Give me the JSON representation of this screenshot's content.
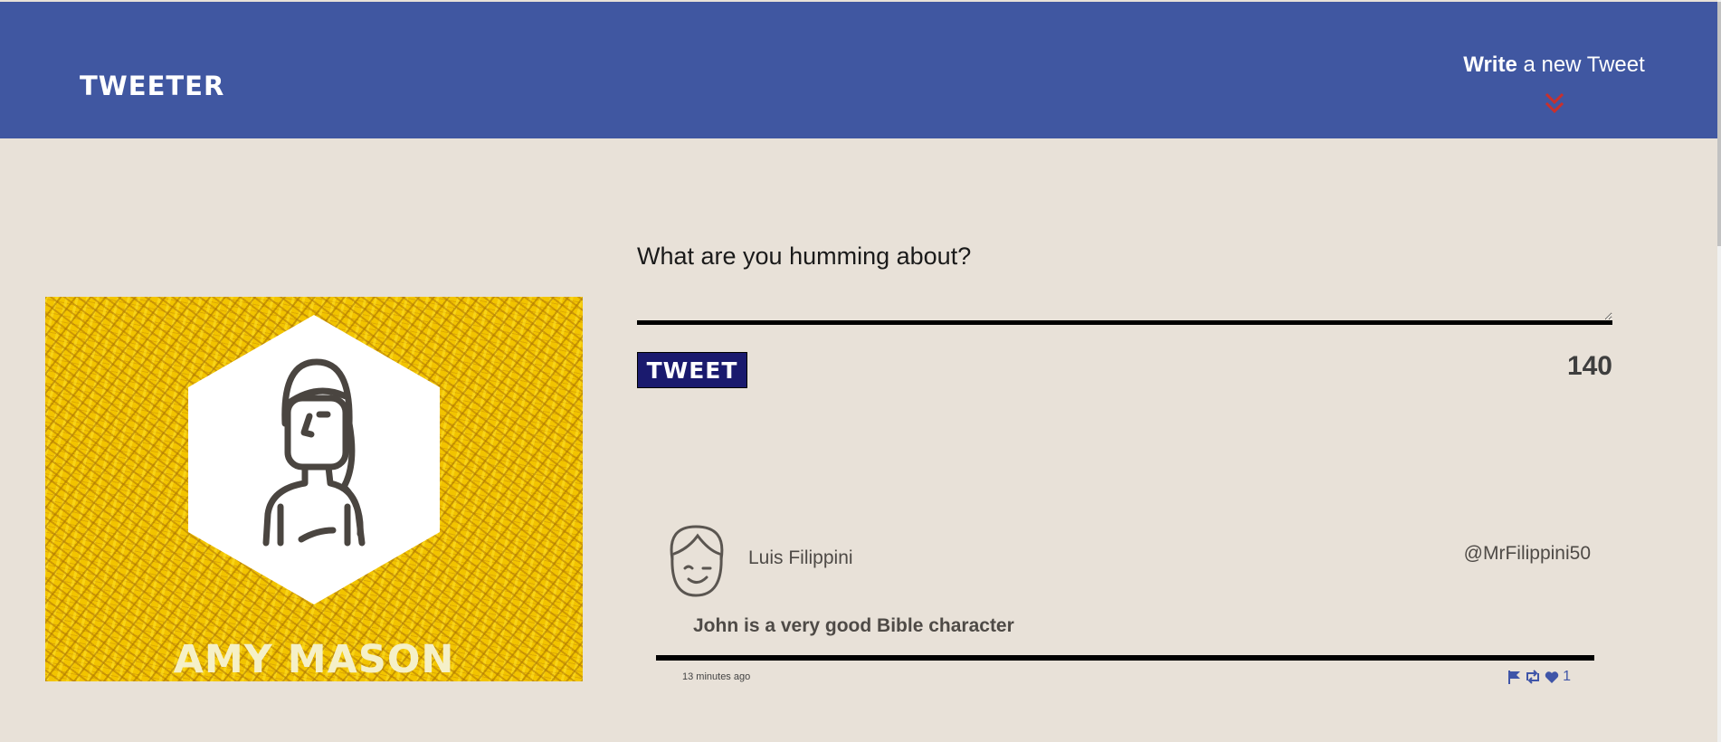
{
  "header": {
    "brand": "TWEETER",
    "compose_strong": "Write",
    "compose_rest": " a new Tweet",
    "chevron_icon": "double-chevron-down-icon",
    "chevron_color": "#c8302d"
  },
  "profile": {
    "name": "AMY MASON",
    "avatar_icon": "woman-avatar-icon",
    "background_color": "#f2c400"
  },
  "compose": {
    "label": "What are you humming about?",
    "textarea_value": "",
    "button_label": "TWEET",
    "counter": "140"
  },
  "tweets": [
    {
      "avatar_icon": "man-avatar-icon",
      "author": "Luis Filippini",
      "handle": "@MrFilippini50",
      "content": "John is a very good Bible character",
      "time": "13 minutes ago",
      "actions": [
        "flag-icon",
        "retweet-icon",
        "heart-icon"
      ],
      "likes": "1"
    }
  ],
  "colors": {
    "header_bg": "#4057a1",
    "page_bg": "#e8e1d8",
    "button_bg": "#1a1a6e",
    "action_icons": "#3f55a8"
  }
}
